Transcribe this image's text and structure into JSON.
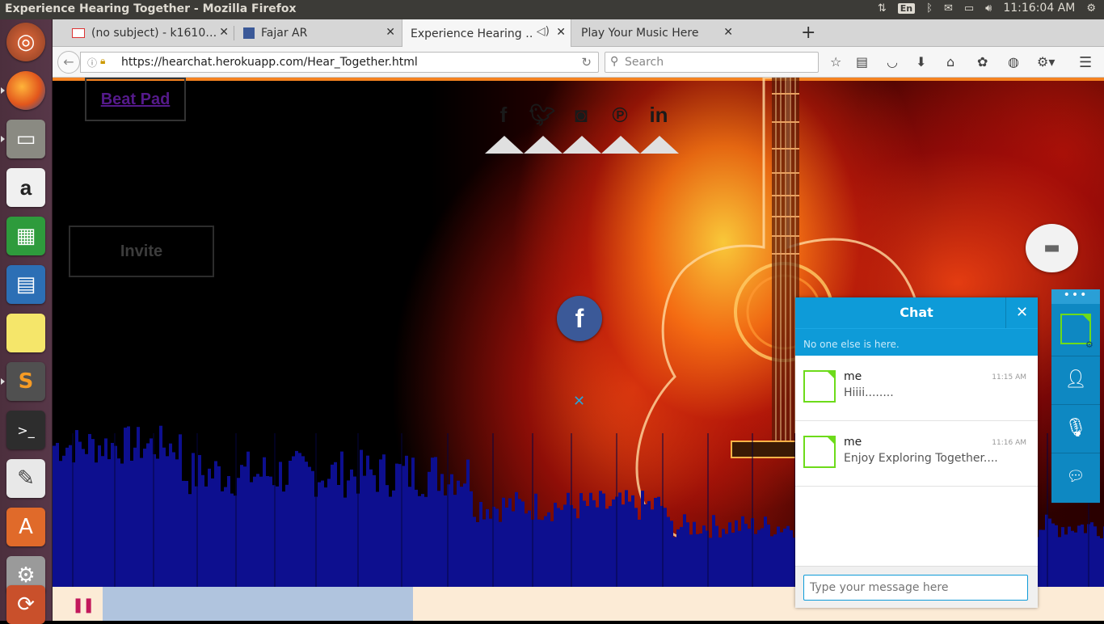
{
  "os_panel": {
    "window_title": "Experience Hearing Together - Mozilla Firefox",
    "lang": "En",
    "clock": "11:16:04 AM"
  },
  "launcher": {
    "items": [
      "ubuntu-dash",
      "firefox",
      "files",
      "amazon",
      "libreoffice-calc",
      "libreoffice-impress",
      "sticky-notes",
      "sublime-text",
      "terminal",
      "text-editor",
      "software-center",
      "system-settings",
      "software-updater"
    ]
  },
  "browser": {
    "tabs": [
      {
        "title": "(no subject) - k1610…"
      },
      {
        "title": "Fajar AR"
      },
      {
        "title": "Experience Hearing …"
      },
      {
        "title": "Play Your Music Here"
      }
    ],
    "url": "https://hearchat.herokuapp.com/Hear_Together.html",
    "search_placeholder": "Search"
  },
  "page": {
    "beat_pad": "Beat Pad",
    "invite": "Invite",
    "facebook_glyph": "f",
    "close_glyph": "✕"
  },
  "chat": {
    "title": "Chat",
    "status": "No one else is here.",
    "messages": [
      {
        "sender": "me",
        "time": "11:15 AM",
        "text": "Hiiii........"
      },
      {
        "sender": "me",
        "time": "11:16 AM",
        "text": "Enjoy Exploring Together...."
      }
    ],
    "input_placeholder": "Type your message here"
  },
  "player": {
    "progress_fraction": 0.31
  },
  "colors": {
    "accent_blue": "#0e9bd8",
    "avatar_green": "#6ddb1a",
    "visualizer_bar": "#0d0f8f",
    "pause_pink": "#c2185b"
  }
}
